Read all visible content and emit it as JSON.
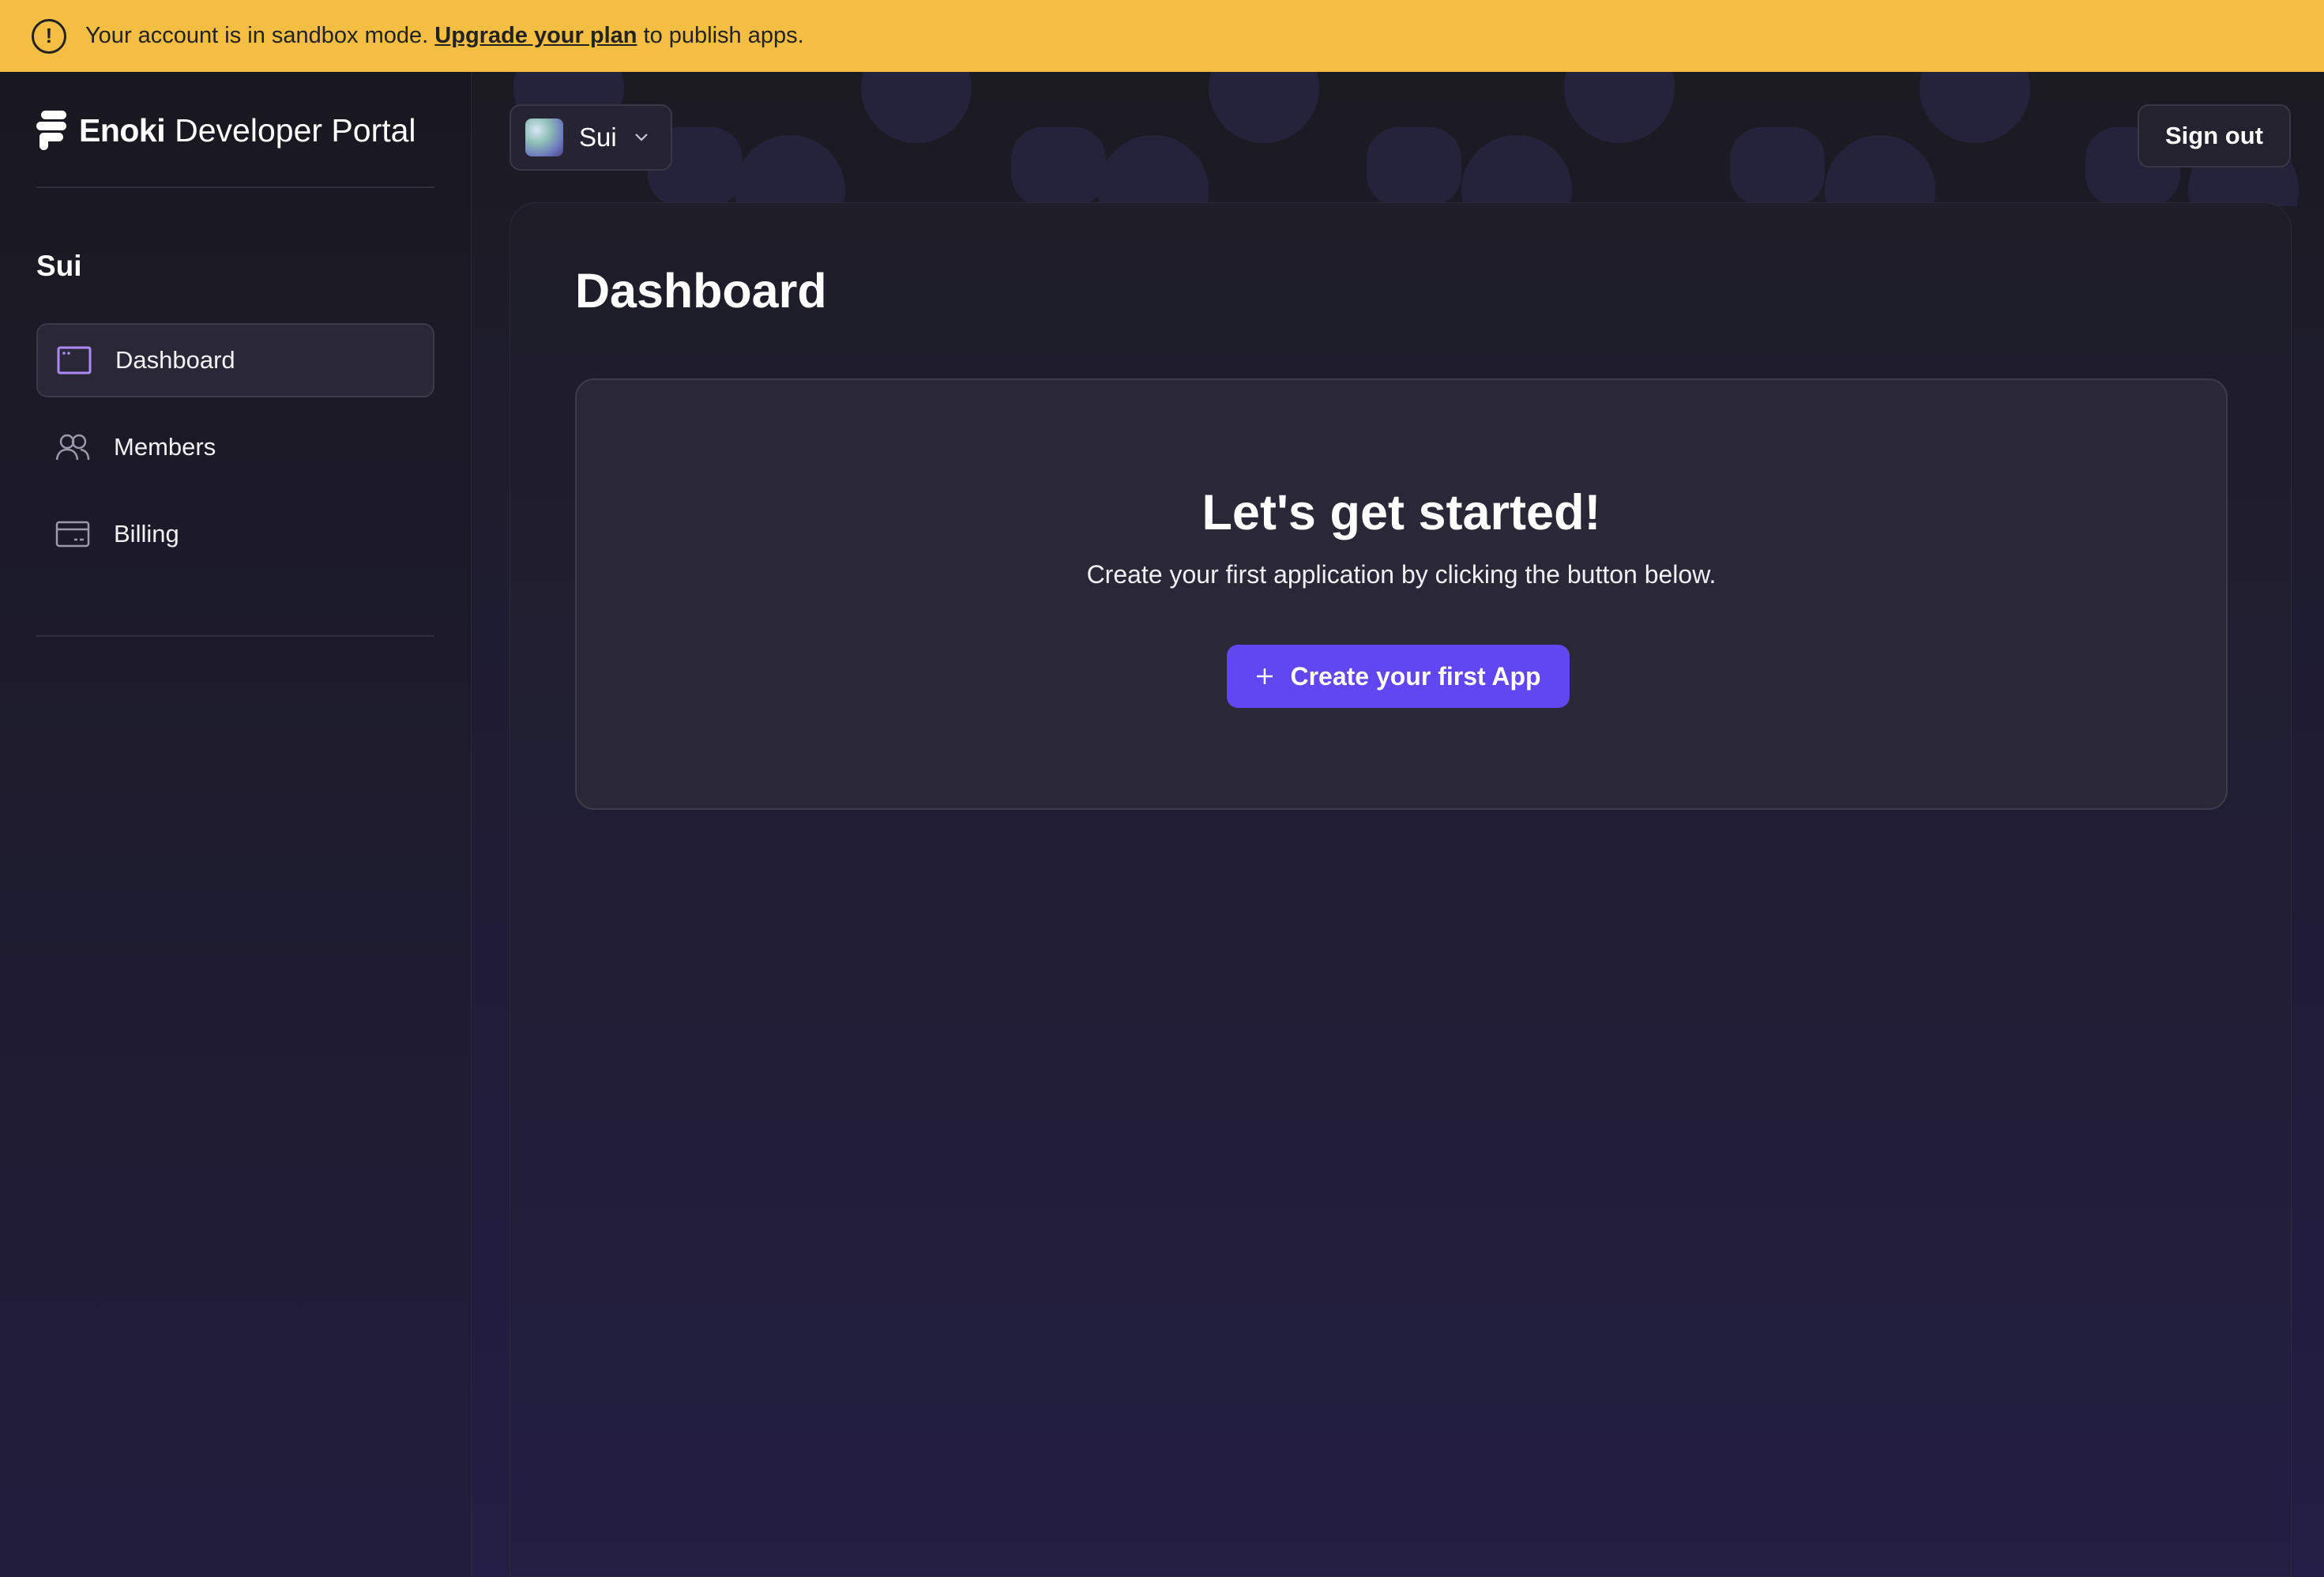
{
  "banner": {
    "message": "Your account is in sandbox mode.",
    "link": "Upgrade your plan",
    "suffix": "to publish apps.",
    "color": "#f4be43"
  },
  "brand": {
    "name": "Enoki",
    "subtitle": "Developer Portal"
  },
  "sidebar": {
    "org_title": "Sui",
    "items": [
      {
        "label": "Dashboard",
        "icon": "dashboard-icon",
        "active": true
      },
      {
        "label": "Members",
        "icon": "members-icon",
        "active": false
      },
      {
        "label": "Billing",
        "icon": "billing-icon",
        "active": false
      }
    ]
  },
  "topbar": {
    "org_name": "Sui",
    "sign_out": "Sign out"
  },
  "main": {
    "page_title": "Dashboard",
    "card": {
      "title": "Let's get started!",
      "subtitle": "Create your first application by clicking the button below.",
      "cta": "Create your first App"
    }
  },
  "colors": {
    "accent": "#6047f2",
    "background": "#1b1a24",
    "panel": "#2a2837"
  }
}
